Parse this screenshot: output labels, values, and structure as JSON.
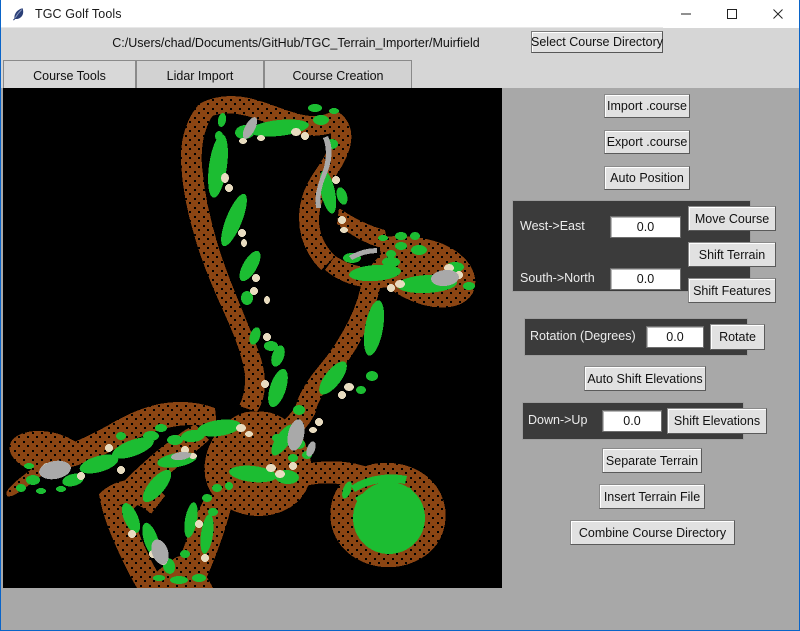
{
  "window": {
    "title": "TGC Golf Tools",
    "icon": "feather-icon",
    "controls": {
      "minimize": "minimize-icon",
      "maximize": "maximize-icon",
      "close": "close-icon"
    }
  },
  "toolbar": {
    "course_path": "C:/Users/chad/Documents/GitHub/TGC_Terrain_Importer/Muirfield",
    "select_course_directory_label": "Select Course Directory"
  },
  "tabs": [
    {
      "label": "Course Tools",
      "active": true
    },
    {
      "label": "Lidar Import",
      "active": false
    },
    {
      "label": "Course Creation",
      "active": false
    }
  ],
  "panel": {
    "import_course_label": "Import .course",
    "export_course_label": "Export .course",
    "auto_position_label": "Auto Position",
    "move_group": {
      "west_east_label": "West->East",
      "west_east_value": "0.0",
      "south_north_label": "South->North",
      "south_north_value": "0.0",
      "move_course_label": "Move Course",
      "shift_terrain_label": "Shift Terrain",
      "shift_features_label": "Shift Features"
    },
    "rotation_group": {
      "rotation_label": "Rotation (Degrees)",
      "rotation_value": "0.0",
      "rotate_label": "Rotate"
    },
    "auto_shift_elevations_label": "Auto Shift Elevations",
    "elevation_group": {
      "down_up_label": "Down->Up",
      "down_up_value": "0.0",
      "shift_elevations_label": "Shift Elevations"
    },
    "separate_terrain_label": "Separate Terrain",
    "insert_terrain_file_label": "Insert Terrain File",
    "combine_course_directory_label": "Combine Course Directory"
  },
  "map": {
    "name": "course-terrain-preview",
    "background_color": "#000000",
    "colors": {
      "rough": "#8B4513",
      "rough_dots": "#000000",
      "fairway_green": "#1CBD32",
      "bunker_sand": "#E8DCC0",
      "cartpath_gray": "#A9A9A9"
    }
  }
}
